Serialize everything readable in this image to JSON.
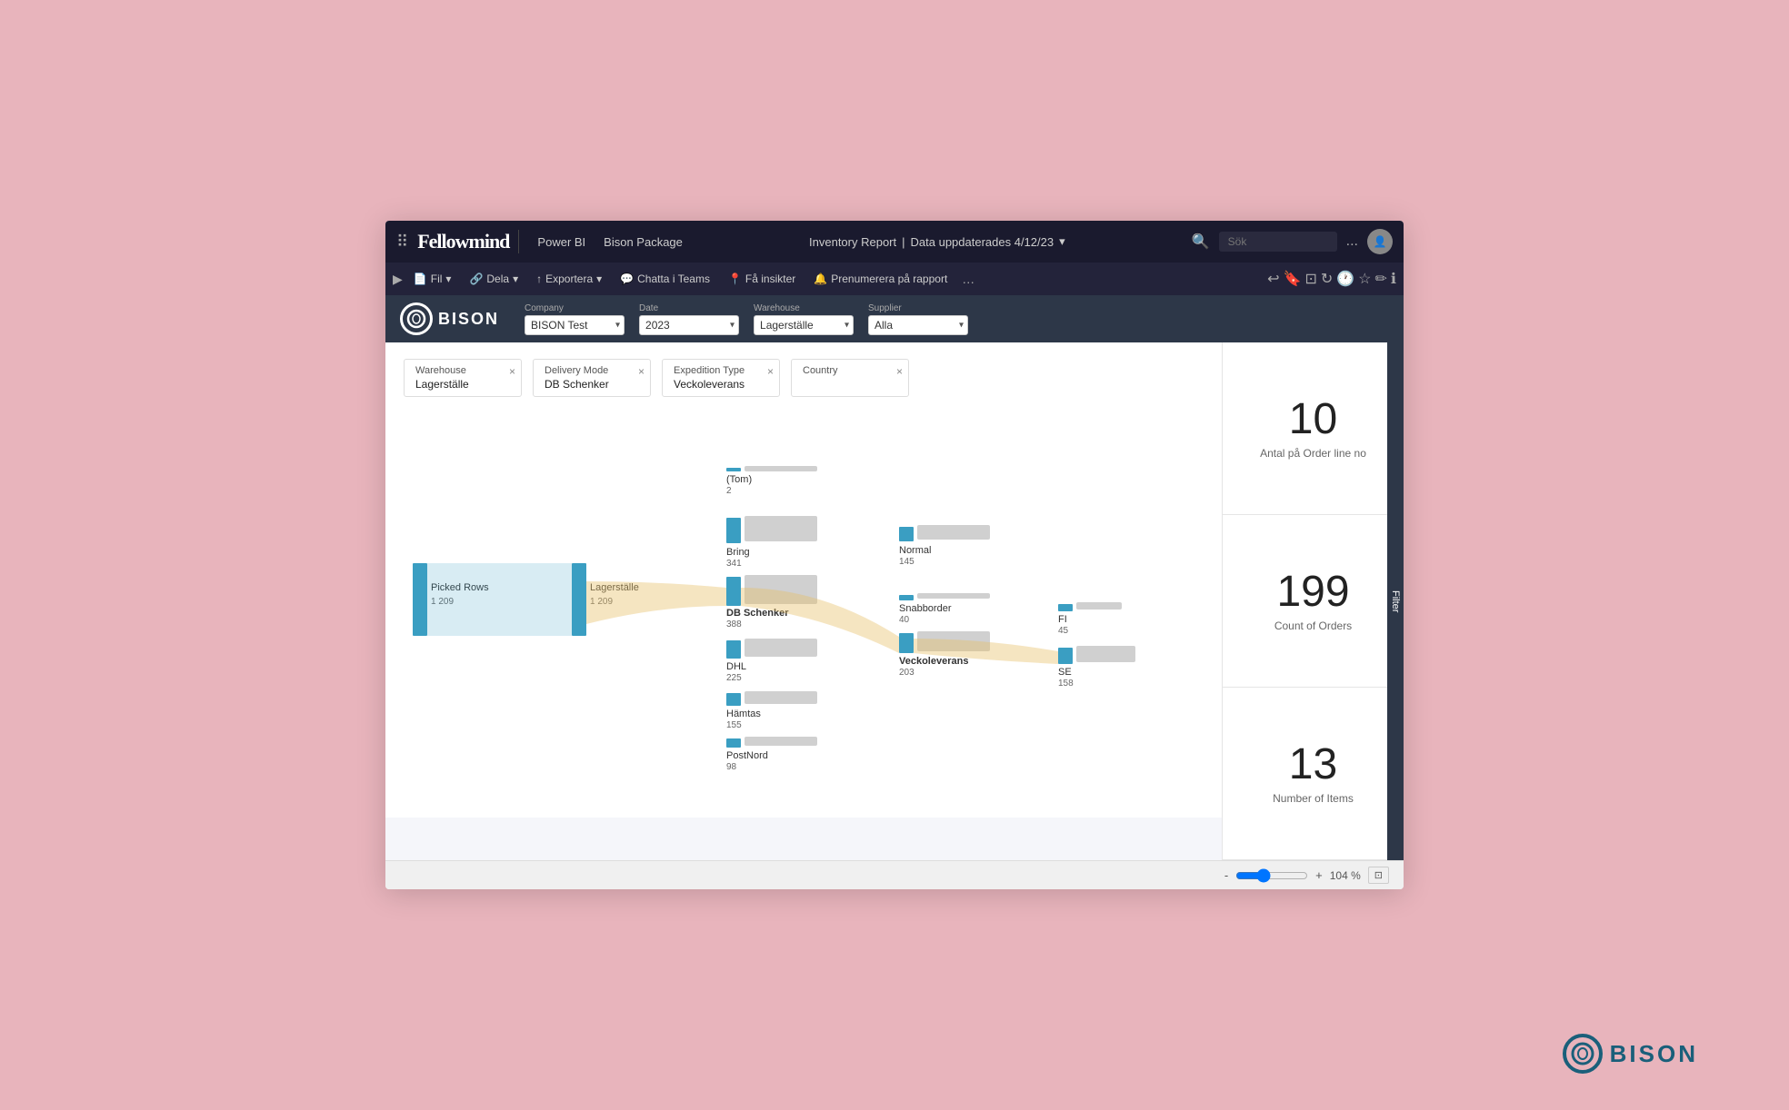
{
  "app": {
    "title": "Fellowmind",
    "powerbi_label": "Power BI",
    "package_label": "Bison Package",
    "report_title": "Inventory Report",
    "data_updated": "Data uppdaterades 4/12/23",
    "search_placeholder": "Sök",
    "more_options": "...",
    "filter_side_label": "Filter"
  },
  "toolbar": {
    "items": [
      {
        "label": "Fil",
        "icon": "📄"
      },
      {
        "label": "Dela",
        "icon": "🔗"
      },
      {
        "label": "Exportera",
        "icon": "⬆"
      },
      {
        "label": "Chatta i Teams",
        "icon": "💬"
      },
      {
        "label": "Få insikter",
        "icon": "📍"
      },
      {
        "label": "Prenumerera på rapport",
        "icon": "🔔"
      }
    ]
  },
  "filterbar": {
    "bison_label": "BISON",
    "filters": [
      {
        "label": "Company",
        "value": "BISON Test"
      },
      {
        "label": "Date",
        "value": "2023"
      },
      {
        "label": "Warehouse",
        "value": "Lagerställe"
      },
      {
        "label": "Supplier",
        "value": "Alla"
      }
    ]
  },
  "chips": [
    {
      "label": "Warehouse",
      "value": "Lagerställe"
    },
    {
      "label": "Delivery Mode",
      "value": "DB Schenker"
    },
    {
      "label": "Expedition Type",
      "value": "Veckoleverans"
    },
    {
      "label": "Country",
      "value": ""
    }
  ],
  "kpi": [
    {
      "number": "10",
      "label": "Antal på Order line no"
    },
    {
      "number": "199",
      "label": "Count of Orders"
    },
    {
      "number": "13",
      "label": "Number of Items"
    }
  ],
  "sankey": {
    "nodes": {
      "picked_rows": {
        "label": "Picked Rows",
        "value": "1 209"
      },
      "lagerställe": {
        "label": "Lagerställe",
        "value": "1 209"
      },
      "tom": {
        "label": "(Tom)",
        "value": "2"
      },
      "bring": {
        "label": "Bring",
        "value": "341"
      },
      "db_schenker": {
        "label": "DB Schenker",
        "value": "388"
      },
      "dhl": {
        "label": "DHL",
        "value": "225"
      },
      "hämtas": {
        "label": "Hämtas",
        "value": "155"
      },
      "postnord": {
        "label": "PostNord",
        "value": "98"
      },
      "normal": {
        "label": "Normal",
        "value": "145"
      },
      "snabborder": {
        "label": "Snabborder",
        "value": "40"
      },
      "veckoleverans": {
        "label": "Veckoleverans",
        "value": "203"
      },
      "fi": {
        "label": "FI",
        "value": "45"
      },
      "se": {
        "label": "SE",
        "value": "158"
      }
    }
  },
  "bottombar": {
    "zoom_minus": "-",
    "zoom_plus": "+",
    "zoom_value": "104 %",
    "fit_icon": "⊡"
  },
  "bison_bottom": {
    "label": "BISON"
  }
}
